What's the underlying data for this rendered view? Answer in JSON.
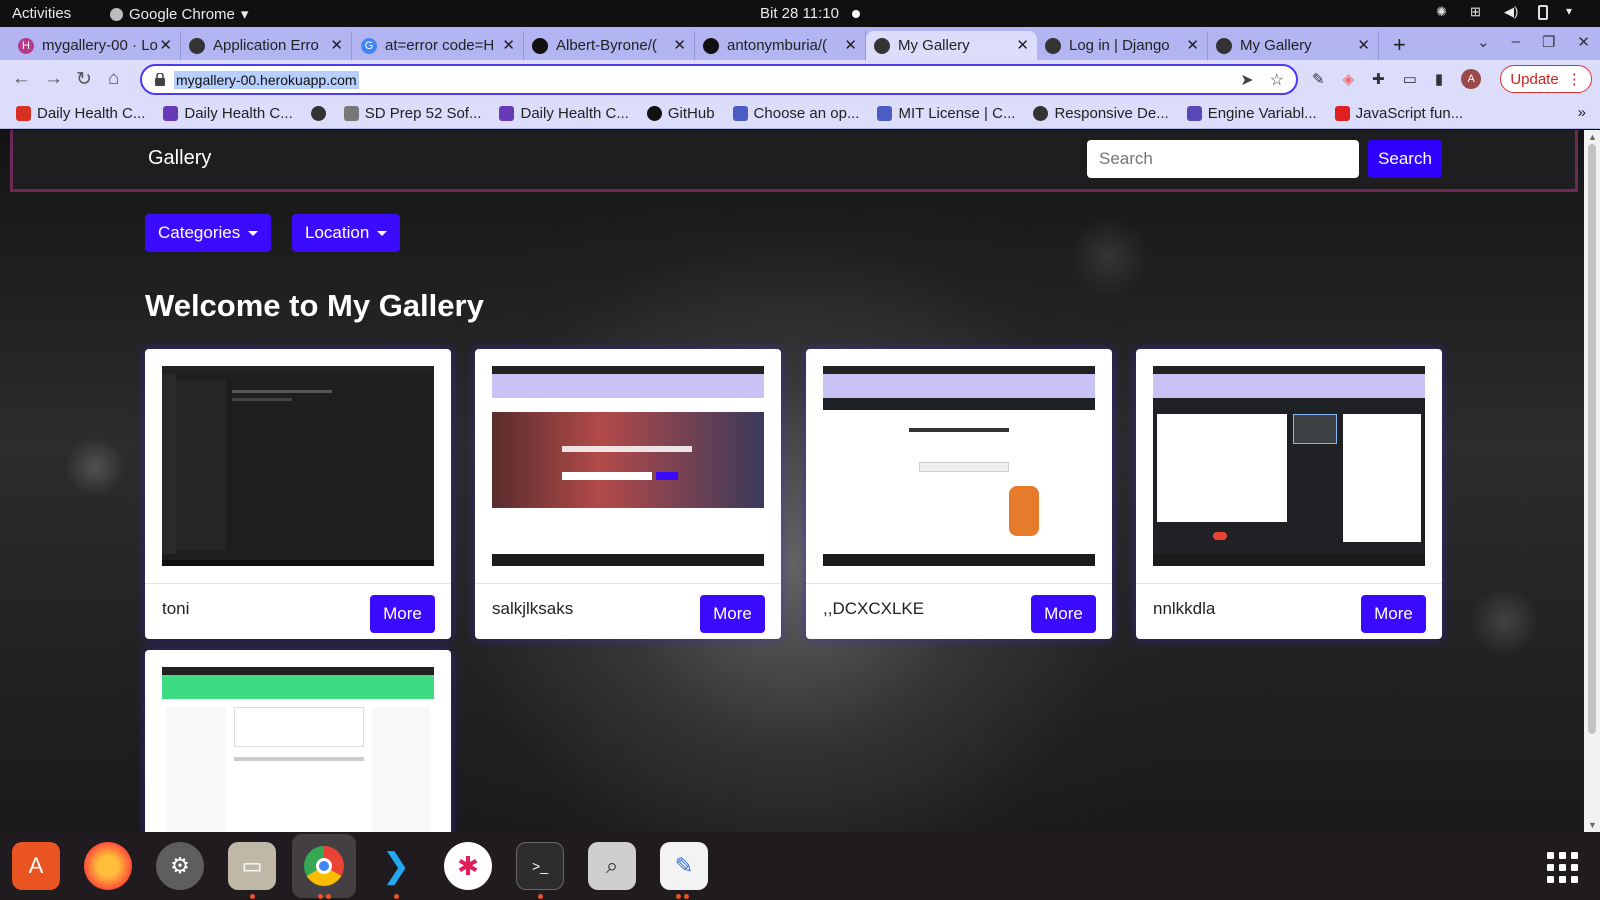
{
  "system_bar": {
    "activities": "Activities",
    "app_name": "Google Chrome",
    "clock": "Bit 28  11:10"
  },
  "browser": {
    "tabs": [
      {
        "title": "mygallery-00 · Lo",
        "favicon_color": "#b43a8c",
        "favicon_glyph": "H"
      },
      {
        "title": "Application Erro",
        "favicon_color": "#333333",
        "favicon_glyph": "globe"
      },
      {
        "title": "at=error code=H",
        "favicon_color": "#4285f4",
        "favicon_glyph": "G"
      },
      {
        "title": "Albert-Byrone/(",
        "favicon_color": "#111111",
        "favicon_glyph": "github"
      },
      {
        "title": "antonymburia/(",
        "favicon_color": "#111111",
        "favicon_glyph": "github"
      },
      {
        "title": "My Gallery",
        "favicon_color": "#333333",
        "favicon_glyph": "globe"
      },
      {
        "title": "Log in | Django",
        "favicon_color": "#333333",
        "favicon_glyph": "globe"
      },
      {
        "title": "My Gallery",
        "favicon_color": "#333333",
        "favicon_glyph": "globe"
      }
    ],
    "active_tab_index": 5,
    "url": "mygallery-00.herokuapp.com",
    "update_label": "Update",
    "profile_initial": "A",
    "bookmarks": [
      {
        "label": "Daily Health C...",
        "icon": "gmail-icon",
        "color": "#d93025"
      },
      {
        "label": "Daily Health C...",
        "icon": "form-icon",
        "color": "#673ab7"
      },
      {
        "label": "",
        "icon": "globe-icon",
        "color": "#333333"
      },
      {
        "label": "SD Prep 52 Sof...",
        "icon": "tree-icon",
        "color": "#777777"
      },
      {
        "label": "Daily Health C...",
        "icon": "form-icon",
        "color": "#673ab7"
      },
      {
        "label": "GitHub",
        "icon": "github-icon",
        "color": "#111111"
      },
      {
        "label": "Choose an op...",
        "icon": "help-icon",
        "color": "#4b5cc4"
      },
      {
        "label": "MIT License | C...",
        "icon": "help-icon",
        "color": "#4b5cc4"
      },
      {
        "label": "Responsive De...",
        "icon": "globe-icon",
        "color": "#333333"
      },
      {
        "label": "Engine Variabl...",
        "icon": "heroku-icon",
        "color": "#5a48b6"
      },
      {
        "label": "JavaScript fun...",
        "icon": "vivaldi-icon",
        "color": "#e02020"
      }
    ]
  },
  "site": {
    "brand": "Gallery",
    "search": {
      "placeholder": "Search",
      "button_label": "Search"
    },
    "dropdowns": {
      "categories": "Categories",
      "location": "Location"
    },
    "heading": "Welcome to My Gallery",
    "more_label": "More",
    "images": [
      {
        "name": "toni",
        "thumb_theme": "dark-editor"
      },
      {
        "name": "salkjlksaks",
        "thumb_theme": "freelance-site"
      },
      {
        "name": ",,DCXCXLKE",
        "thumb_theme": "linkedin-page"
      },
      {
        "name": "nnlkkdla",
        "thumb_theme": "video-call"
      },
      {
        "name": "",
        "thumb_theme": "github-page"
      }
    ]
  },
  "dock": {
    "apps": [
      "software-center-icon",
      "firefox-icon",
      "settings-icon",
      "files-icon",
      "chrome-icon",
      "vscode-icon",
      "slack-icon",
      "terminal-icon",
      "screenshot-icon",
      "text-editor-icon"
    ],
    "running_indicators": [
      "files-icon",
      "chrome-icon",
      "vscode-icon",
      "terminal-icon",
      "text-editor-icon"
    ]
  },
  "colors": {
    "accent": "#3b0bff",
    "tabstrip": "#b3b4f2",
    "toolbar": "#dcdcfb",
    "nav_border": "#6a2a55"
  }
}
